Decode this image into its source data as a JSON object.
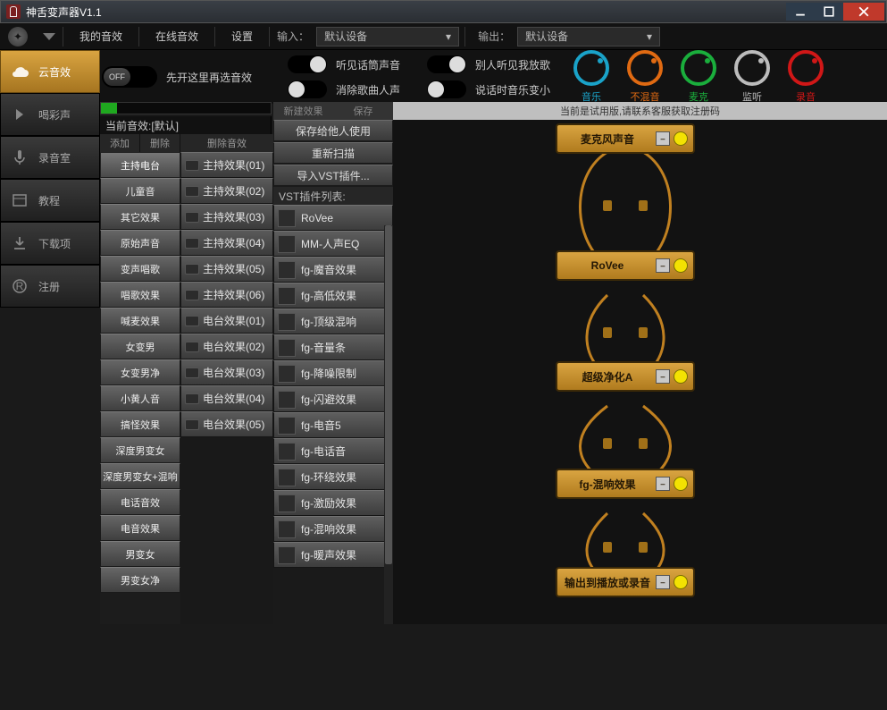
{
  "window": {
    "title": "神舌变声器V1.1"
  },
  "menu": {
    "my_fx": "我的音效",
    "online_fx": "在线音效",
    "settings": "设置"
  },
  "io": {
    "input_label": "输入：",
    "input_value": "默认设备",
    "output_label": "输出：",
    "output_value": "默认设备"
  },
  "power": {
    "off_text": "OFF",
    "hint": "先开这里再选音效"
  },
  "toggles": {
    "hear_mic": "听见话筒声音",
    "others_hear": "别人听见我放歌",
    "remove_vocal": "消除歌曲人声",
    "talk_lower": "说话时音乐变小"
  },
  "dials": [
    {
      "label": "音乐",
      "color": "#1aa3c9"
    },
    {
      "label": "不混音",
      "color": "#e06a12"
    },
    {
      "label": "麦克",
      "color": "#1aae3c"
    },
    {
      "label": "监听",
      "color": "#bcbcbc"
    },
    {
      "label": "录音",
      "color": "#d01717"
    }
  ],
  "bigtabs": [
    {
      "id": "cloud",
      "label": "云音效",
      "active": true
    },
    {
      "id": "cheer",
      "label": "喝彩声"
    },
    {
      "id": "studio",
      "label": "录音室"
    },
    {
      "id": "tutorial",
      "label": "教程"
    },
    {
      "id": "download",
      "label": "下载项"
    },
    {
      "id": "register",
      "label": "注册"
    }
  ],
  "current_fx": {
    "label": "当前音效:[默认]"
  },
  "col1": {
    "hdr_add": "添加",
    "hdr_del": "删除",
    "items": [
      "主持电台",
      "儿童音",
      "其它效果",
      "原始声音",
      "变声唱歌",
      "唱歌效果",
      "喊麦效果",
      "女变男",
      "女变男净",
      "小黄人音",
      "搞怪效果",
      "深度男变女",
      "深度男变女+混响",
      "电话音效",
      "电音效果",
      "男变女",
      "男变女净"
    ]
  },
  "col2": {
    "hdr": "删除音效",
    "items": [
      "主持效果(01)",
      "主持效果(02)",
      "主持效果(03)",
      "主持效果(04)",
      "主持效果(05)",
      "主持效果(06)",
      "电台效果(01)",
      "电台效果(02)",
      "电台效果(03)",
      "电台效果(04)",
      "电台效果(05)"
    ]
  },
  "col3": {
    "new_fx": "新建效果",
    "save": "保存",
    "save_others": "保存给他人使用",
    "rescan": "重新扫描",
    "import_vst": "导入VST插件...",
    "list_label": "VST插件列表:",
    "items": [
      "RoVee",
      "MM-人声EQ",
      "fg-魔音效果",
      "fg-高低效果",
      "fg-顶级混响",
      "fg-音量条",
      "fg-降噪限制",
      "fg-闪避效果",
      "fg-电音5",
      "fg-电话音",
      "fg-环绕效果",
      "fg-激励效果",
      "fg-混响效果",
      "fg-暖声效果"
    ]
  },
  "trial": "当前是试用版,请联系客服获取注册码",
  "nodes": [
    "麦克风声音",
    "RoVee",
    "超级净化A",
    "fg-混响效果",
    "输出到播放或录音"
  ]
}
